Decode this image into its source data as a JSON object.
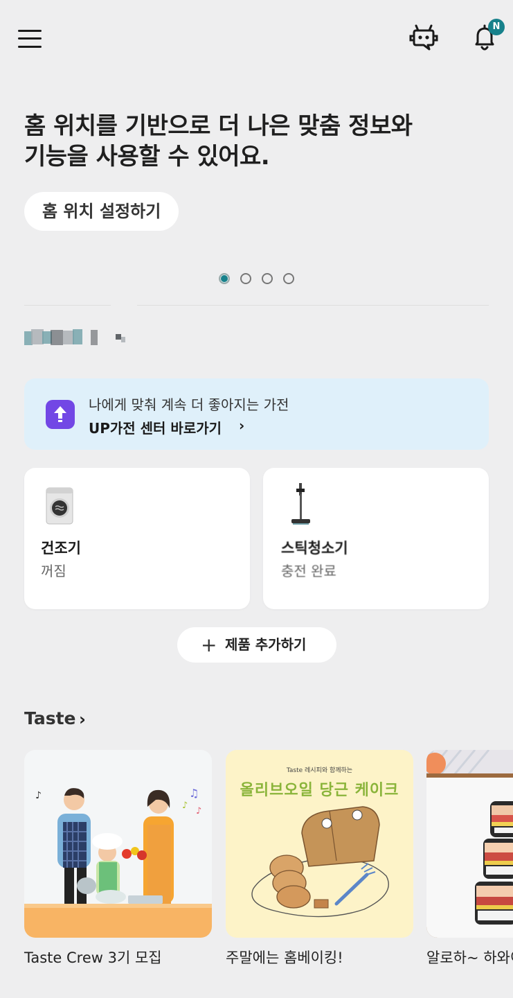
{
  "header": {
    "menu_icon": "hamburger-icon",
    "bot_icon": "chatbot-icon",
    "bell_icon": "bell-icon",
    "notification_badge": "N",
    "accent_color": "#17818b"
  },
  "hero": {
    "line1": "홈 위치를 기반으로 더 나은 맞춤 정보와",
    "line2": "기능을 사용할 수 있어요.",
    "button_label": "홈 위치 설정하기",
    "page_indicator": {
      "count": 4,
      "active_index": 0
    }
  },
  "up_banner": {
    "line1": "나에게 맞춰 계속 더 좋아지는 가전",
    "line2": "UP가전 센터 바로가기",
    "chevron": "›",
    "icon": "upgrade-arrow-icon",
    "icon_color": "#7247e5",
    "background": "#dff0fa"
  },
  "devices": [
    {
      "name": "건조기",
      "status": "꺼짐",
      "icon": "dryer-icon"
    },
    {
      "name": "스틱청소기",
      "status": "충전 완료",
      "icon": "stick-vacuum-icon"
    }
  ],
  "add_product": {
    "plus": "+",
    "label": "제품 추가하기"
  },
  "taste": {
    "title": "Taste",
    "chevron": "›",
    "cards": [
      {
        "caption": "Taste  Crew 3기 모집",
        "image": "family-cooking-illustration"
      },
      {
        "caption": "주말에는 홈베이킹!",
        "image": "olive-oil-carrot-cake-illustration",
        "image_text": "올리브오일 당근 케이크",
        "image_subtext": "Taste 레시피와 함께하는"
      },
      {
        "caption": "알로하~ 하와이",
        "image": "spam-musubi-photo"
      }
    ]
  }
}
